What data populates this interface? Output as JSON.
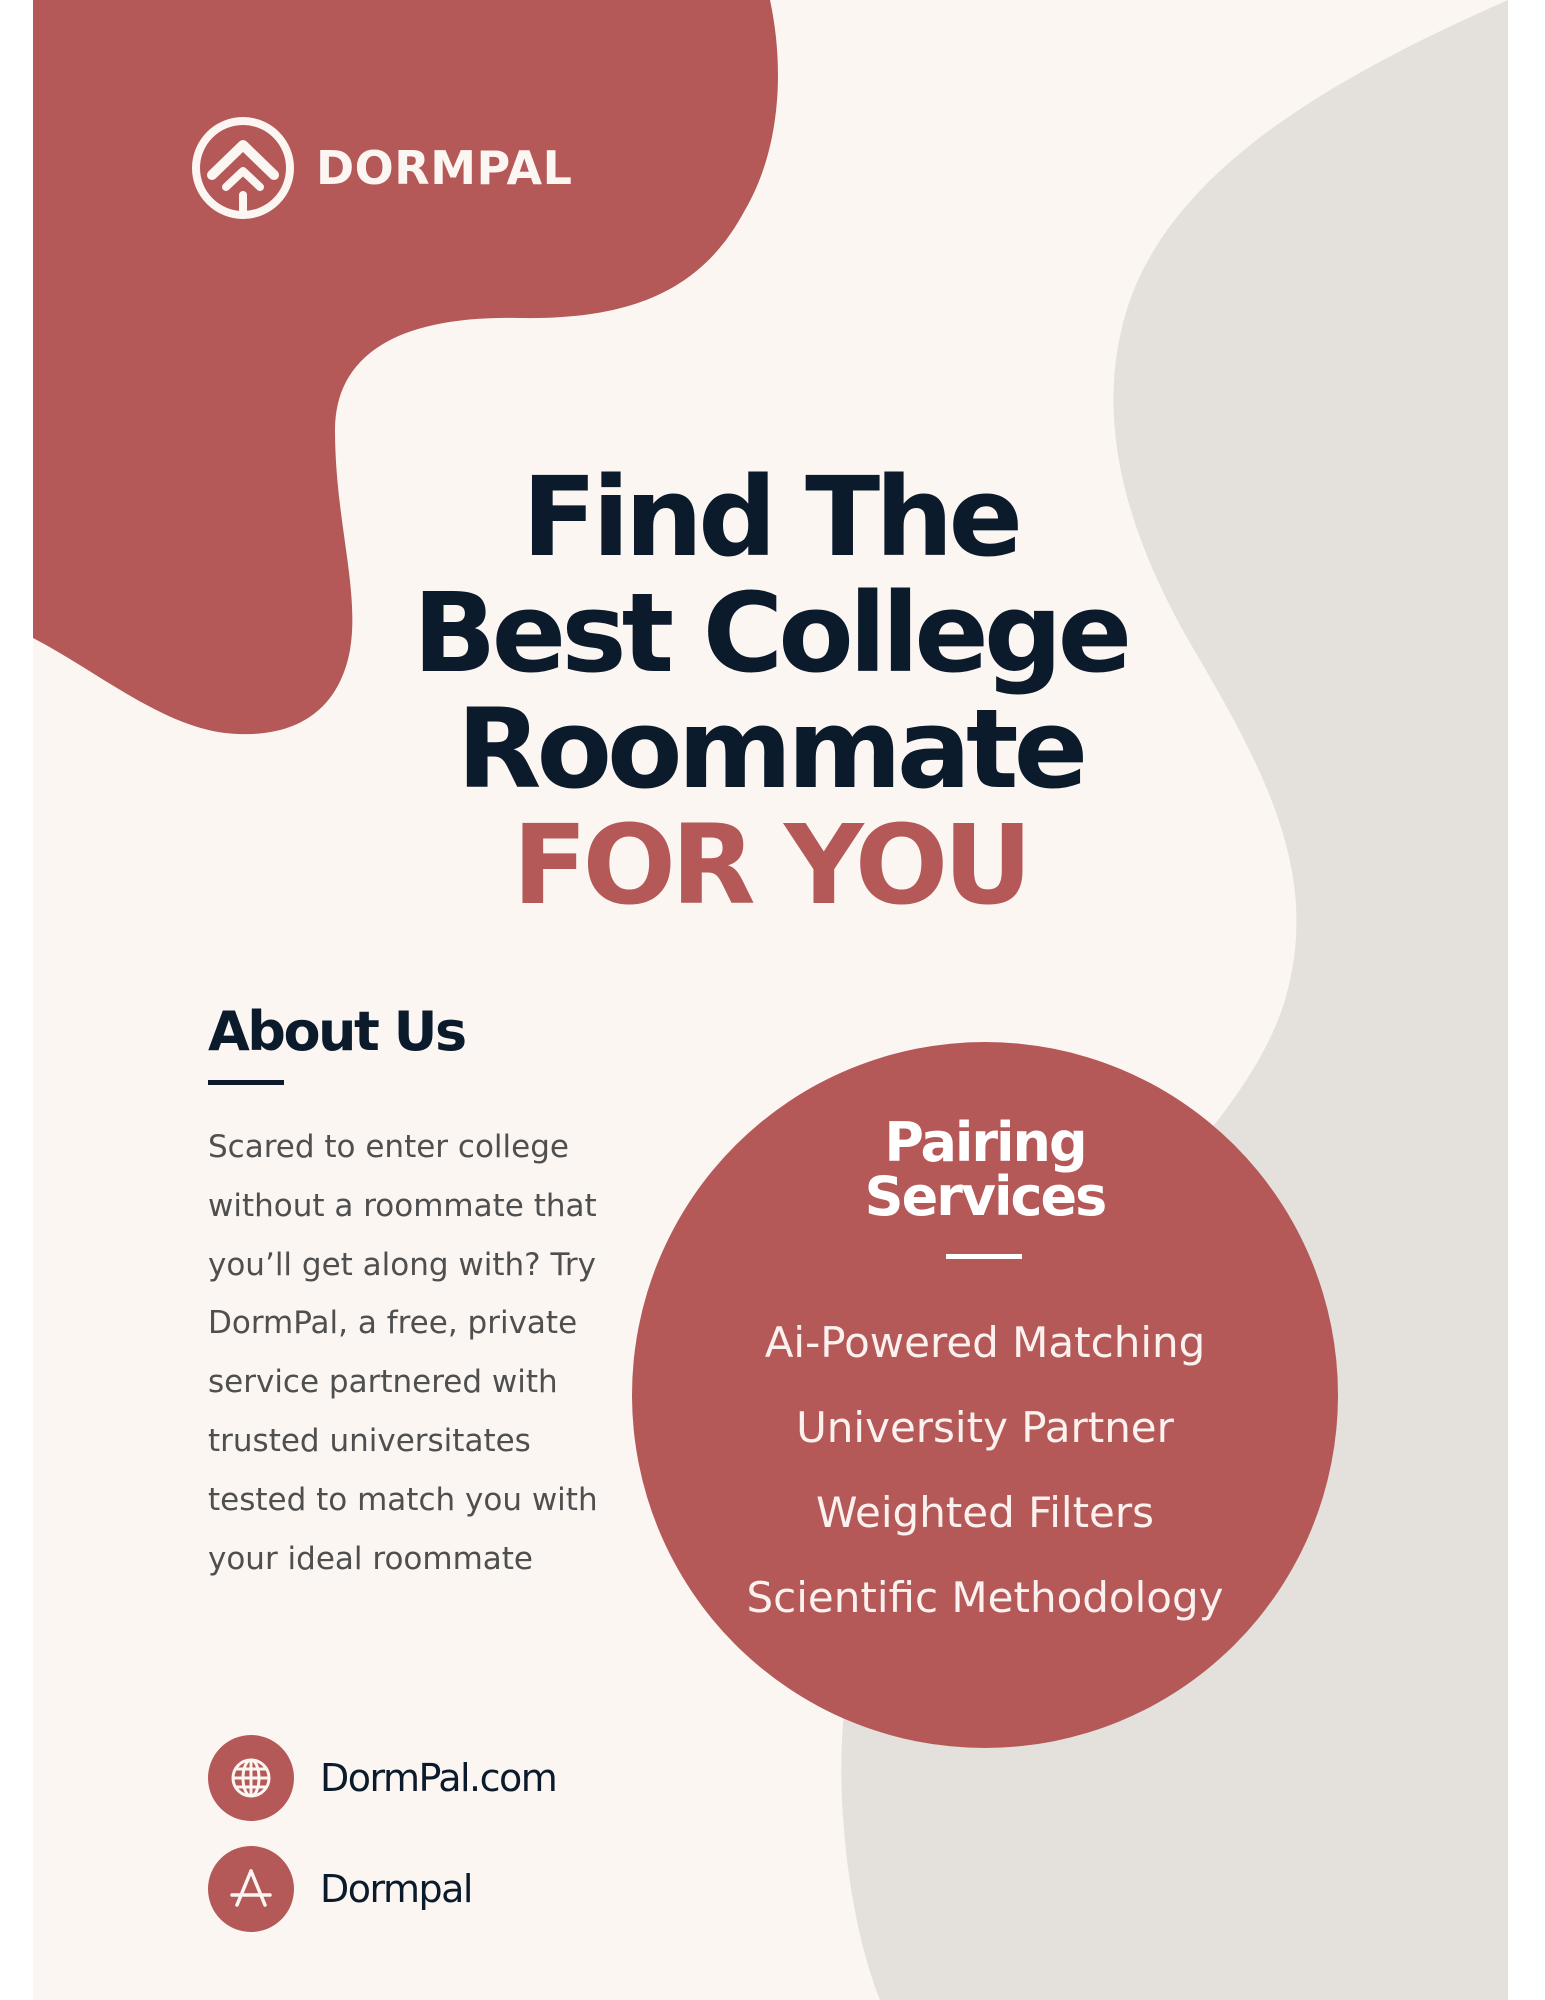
{
  "colors": {
    "background": "#fbf6f2",
    "accent": "#b45858",
    "gray_shape": "#e4e0dc",
    "navy": "#0c1b2c",
    "body_text": "#4f4f4f"
  },
  "brand": {
    "name": "DORMPAL",
    "logo_icon": "dormpal-roof-logo-icon"
  },
  "headline": {
    "line1": "Find  The",
    "line2": "Best College",
    "line3": "Roommate",
    "accent_line": "FOR YOU"
  },
  "about": {
    "title": "About Us",
    "body": "Scared to enter college without a roommate that you’ll get along with? Try DormPal, a free, private service partnered with trusted universitates tested to match you with your ideal roommate"
  },
  "services": {
    "title_line1": "Pairing",
    "title_line2": "Services",
    "items": [
      "Ai-Powered Matching",
      "University Partner",
      "Weighted Filters",
      "Scientific Methodology"
    ]
  },
  "contacts": [
    {
      "icon": "globe-icon",
      "text": "DormPal.com"
    },
    {
      "icon": "app-store-icon",
      "text": "Dormpal"
    }
  ]
}
